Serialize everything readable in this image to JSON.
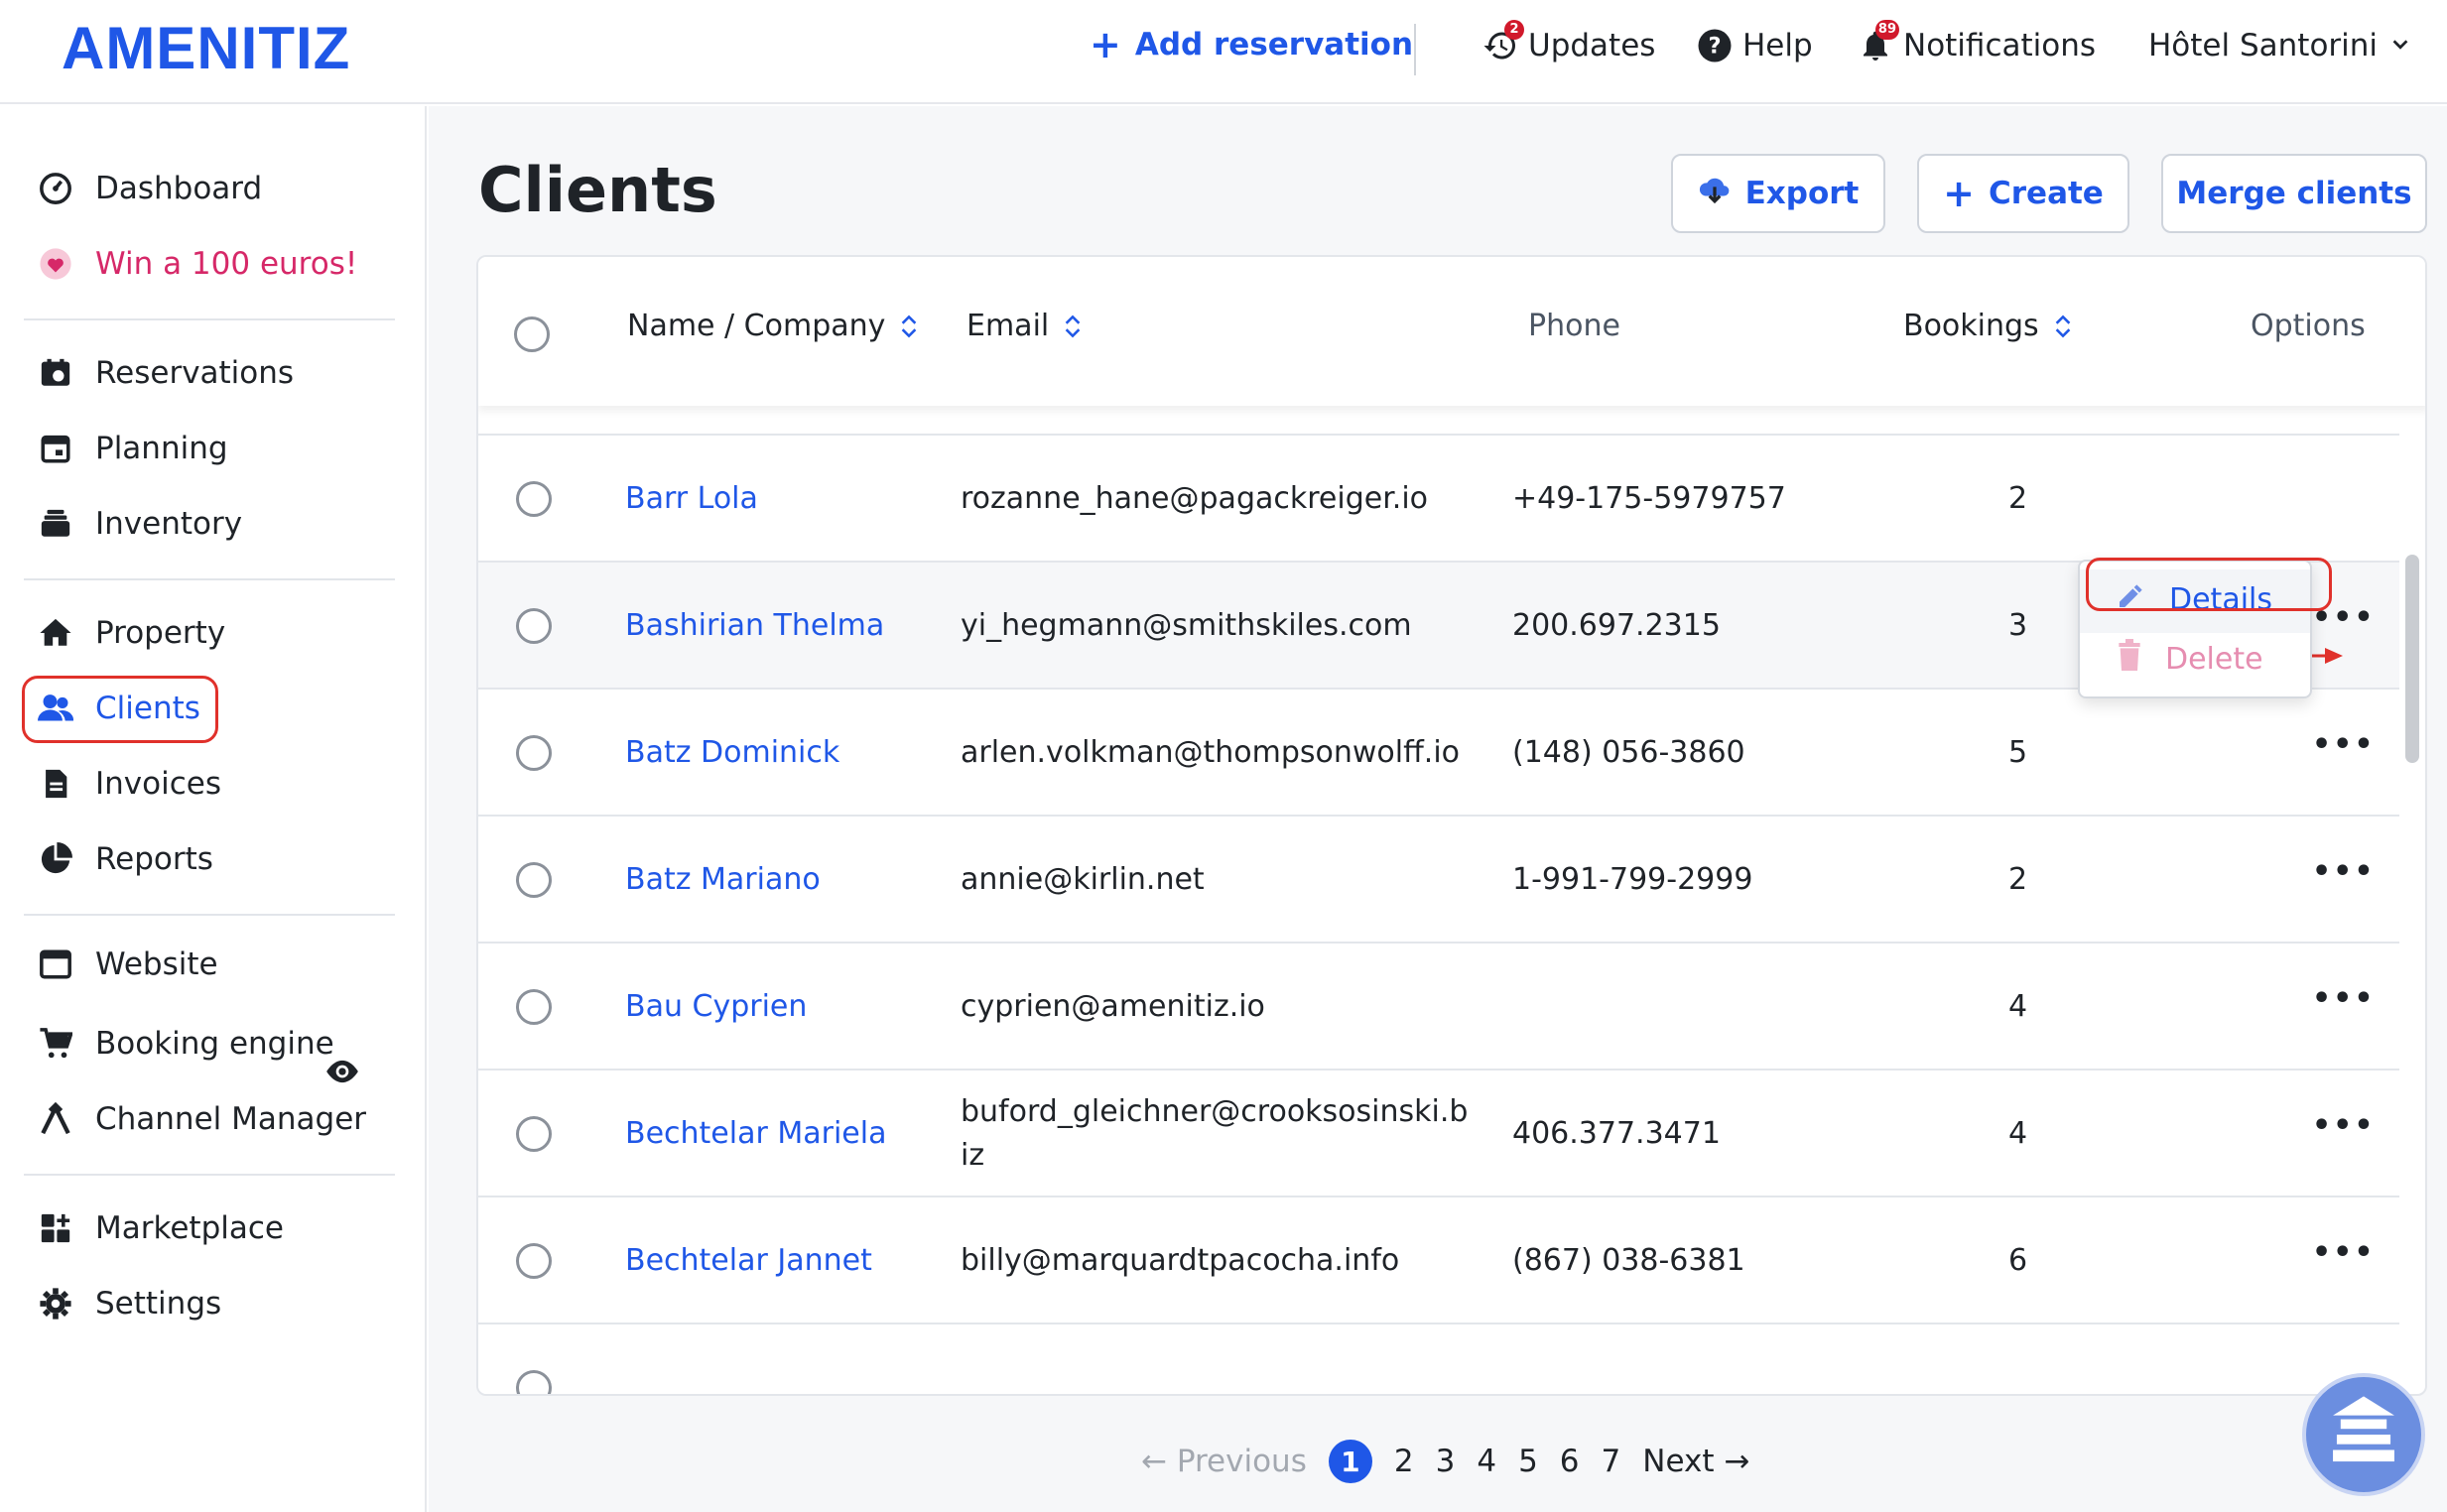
{
  "header": {
    "logo": "AMENITIZ",
    "add_reservation": "Add reservation",
    "updates_label": "Updates",
    "updates_count": "2",
    "help_label": "Help",
    "notifications_label": "Notifications",
    "notifications_count": "89",
    "hotel_name": "Hôtel Santorini"
  },
  "sidebar": {
    "items": [
      {
        "label": "Dashboard",
        "icon": "dashboard-icon"
      },
      {
        "label": "Win a 100 euros!",
        "icon": "heart-icon"
      },
      {
        "label": "Reservations",
        "icon": "reservations-icon"
      },
      {
        "label": "Planning",
        "icon": "calendar-icon"
      },
      {
        "label": "Inventory",
        "icon": "inventory-icon"
      },
      {
        "label": "Property",
        "icon": "home-icon"
      },
      {
        "label": "Clients",
        "icon": "users-icon"
      },
      {
        "label": "Invoices",
        "icon": "document-icon"
      },
      {
        "label": "Reports",
        "icon": "pie-chart-icon"
      },
      {
        "label": "Website",
        "icon": "browser-icon"
      },
      {
        "label": "Booking engine",
        "icon": "cart-icon"
      },
      {
        "label": "Channel Manager",
        "icon": "channel-icon"
      },
      {
        "label": "Marketplace",
        "icon": "marketplace-icon"
      },
      {
        "label": "Settings",
        "icon": "gear-icon"
      }
    ]
  },
  "page": {
    "title": "Clients",
    "export_label": "Export",
    "create_label": "Create",
    "merge_label": "Merge clients"
  },
  "table": {
    "columns": [
      "Name / Company",
      "Email",
      "Phone",
      "Bookings",
      "Options"
    ],
    "rows": [
      {
        "name": "Barr Lola",
        "email": "rozanne_hane@pagackreiger.io",
        "phone": "+49-175-5979757",
        "bookings": "2"
      },
      {
        "name": "Bashirian Thelma",
        "email": "yi_hegmann@smithskiles.com",
        "phone": "200.697.2315",
        "bookings": "3"
      },
      {
        "name": "Batz Dominick",
        "email": "arlen.volkman@thompsonwolff.io",
        "phone": "(148) 056-3860",
        "bookings": "5"
      },
      {
        "name": "Batz Mariano",
        "email": "annie@kirlin.net",
        "phone": "1-991-799-2999",
        "bookings": "2"
      },
      {
        "name": "Bau Cyprien",
        "email": "cyprien@amenitiz.io",
        "phone": "",
        "bookings": "4"
      },
      {
        "name": "Bechtelar Mariela",
        "email": "buford_gleichner@crooksosinski.b iz",
        "phone": "406.377.3471",
        "bookings": "4"
      },
      {
        "name": "Bechtelar Jannet",
        "email": "billy@marquardtpacocha.info",
        "phone": "(867) 038-6381",
        "bookings": "6"
      }
    ]
  },
  "menu": {
    "details": "Details",
    "delete": "Delete"
  },
  "pagination": {
    "previous": "Previous",
    "next": "Next",
    "current": "1",
    "pages": [
      "2",
      "3",
      "4",
      "5",
      "6",
      "7"
    ]
  },
  "colors": {
    "brand": "#1f57e7",
    "promo": "#d62868",
    "highlight": "#e0312b",
    "badge": "#d1192b"
  }
}
